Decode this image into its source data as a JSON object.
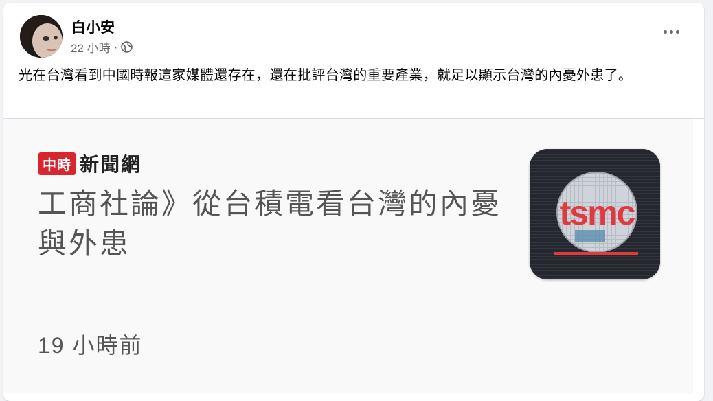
{
  "post": {
    "author": "白小安",
    "time": "22 小時",
    "separator": "·",
    "visibility_icon": "globe-icon",
    "more_icon": "more-options-icon",
    "text": "光在台灣看到中國時報這家媒體還存在，還在批評台灣的重要產業，就足以顯示台灣的內憂外患了。"
  },
  "preview": {
    "badge": "中時",
    "site_name": "新聞網",
    "headline": "工商社論》從台積電看台灣的內憂與外患",
    "time_ago": "19 小時前",
    "logo_text": "tsmc",
    "logo_alt": "tsmc-logo"
  },
  "colors": {
    "background": "#f0f2f5",
    "card": "#ffffff",
    "text_primary": "#050505",
    "text_secondary": "#65676b",
    "badge_red": "#d7262e",
    "tsmc_red": "#e0393e"
  }
}
